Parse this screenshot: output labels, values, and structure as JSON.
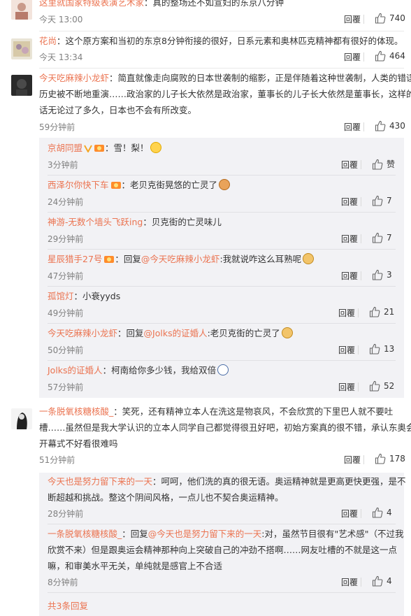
{
  "comments": [
    {
      "user": "这里就国家特级表演艺术家",
      "text": "：真的整场还不如宣妇的东京八分钟",
      "time": "今天 13:00",
      "reply_label": "回覆",
      "likes": "740"
    },
    {
      "user": "花尚",
      "text": "：这个原方案和当初的东京8分钟衔接的很好，日系元素和奥林匹克精神都有很好的体现。",
      "time": "今天 13:34",
      "reply_label": "回覆",
      "likes": "464"
    },
    {
      "user": "今天吃麻辣小龙虾",
      "text_line1": "：简直就像走向腐败的日本世袭制的缩影，正是伴随着这种世袭制，人类的错误",
      "text_line2": "历史被不断地重演……政治家的儿子长大依然是政治家，董事长的儿子长大依然是董事长，这样的",
      "text_line3": "话无论过了多久，日本也不会有所改变。",
      "time": "59分钟前",
      "reply_label": "回覆",
      "likes": "430"
    }
  ],
  "sub_replies": [
    {
      "user": "京胡同盟",
      "text": "：雪！梨！",
      "time": "3分钟前",
      "reply_label": "回覆",
      "likes": "赞"
    },
    {
      "user": "西泽尔你快下车",
      "text": "：老贝克街晃悠的亡灵了",
      "time": "24分钟前",
      "reply_label": "回覆",
      "likes": "7"
    },
    {
      "user": "神游-无数个墙头飞跃ing",
      "text": "：贝克街的亡灵味儿",
      "time": "29分钟前",
      "reply_label": "回覆",
      "likes": "7"
    },
    {
      "user": "星辰猎手27号",
      "text_prefix": "：回复",
      "mention": "@今天吃麻辣小龙虾",
      "text": ":我就说咋这么耳熟呢",
      "time": "47分钟前",
      "reply_label": "回覆",
      "likes": "3"
    },
    {
      "user": "孤馆灯",
      "text": "：小衰yyds",
      "time": "49分钟前",
      "reply_label": "回覆",
      "likes": "21"
    },
    {
      "user": "今天吃麻辣小龙虾",
      "text_prefix": "：回复",
      "mention": "@Jolks的证婚人",
      "text": ":老贝克街的亡灵了",
      "time": "50分钟前",
      "reply_label": "回覆",
      "likes": "13"
    },
    {
      "user": "Jolks的证婚人",
      "text": "：柯南给你多少钱，我给双倍",
      "time": "57分钟前",
      "reply_label": "回覆",
      "likes": "52"
    }
  ],
  "comment4": {
    "user": "一条脱氧核糖核酸_",
    "text_line1": "：笑死，还有精神立本人在洗这是物哀风，不会欣赏的下里巴人就不要吐",
    "text_line2": "槽……虽然但是我大学认识的立本人同学自己都觉得很丑好吧，初始方案真的很不错，承认东奥会",
    "text_line3": "开幕式不好看很难吗",
    "time": "51分钟前",
    "reply_label": "回覆",
    "likes": "178"
  },
  "sub_replies2": [
    {
      "user": "今天也是努力留下来的一天",
      "text_line1": "：呵呵，他们洗的真的很无语。奥运精神就是更高更快更强，是不",
      "text_line2": "断超越和挑战。整这个阴间风格，一点儿也不契合奥运精神。",
      "time": "28分钟前",
      "reply_label": "回覆",
      "likes": "4"
    },
    {
      "user": "一条脱氧核糖核酸_",
      "text_prefix": "：回复",
      "mention": "@今天也是努力留下来的一天",
      "text_line1": ":对，虽然节目很有\"艺术感\"（不过我",
      "text_line2": "欣赏不来）但是跟奥运会精神那种向上突破自己的冲劲不搭啊……网友吐槽的不就是这一点",
      "text_line3": "嘛，和审美水平无关，单纯就是感官上不合适",
      "time": "8分钟前",
      "reply_label": "回覆",
      "likes": "4"
    }
  ],
  "more_replies": "共3条回复",
  "colors": {
    "link": "#eb7350",
    "sub_bg": "#f2f2f5",
    "muted": "#808080"
  }
}
